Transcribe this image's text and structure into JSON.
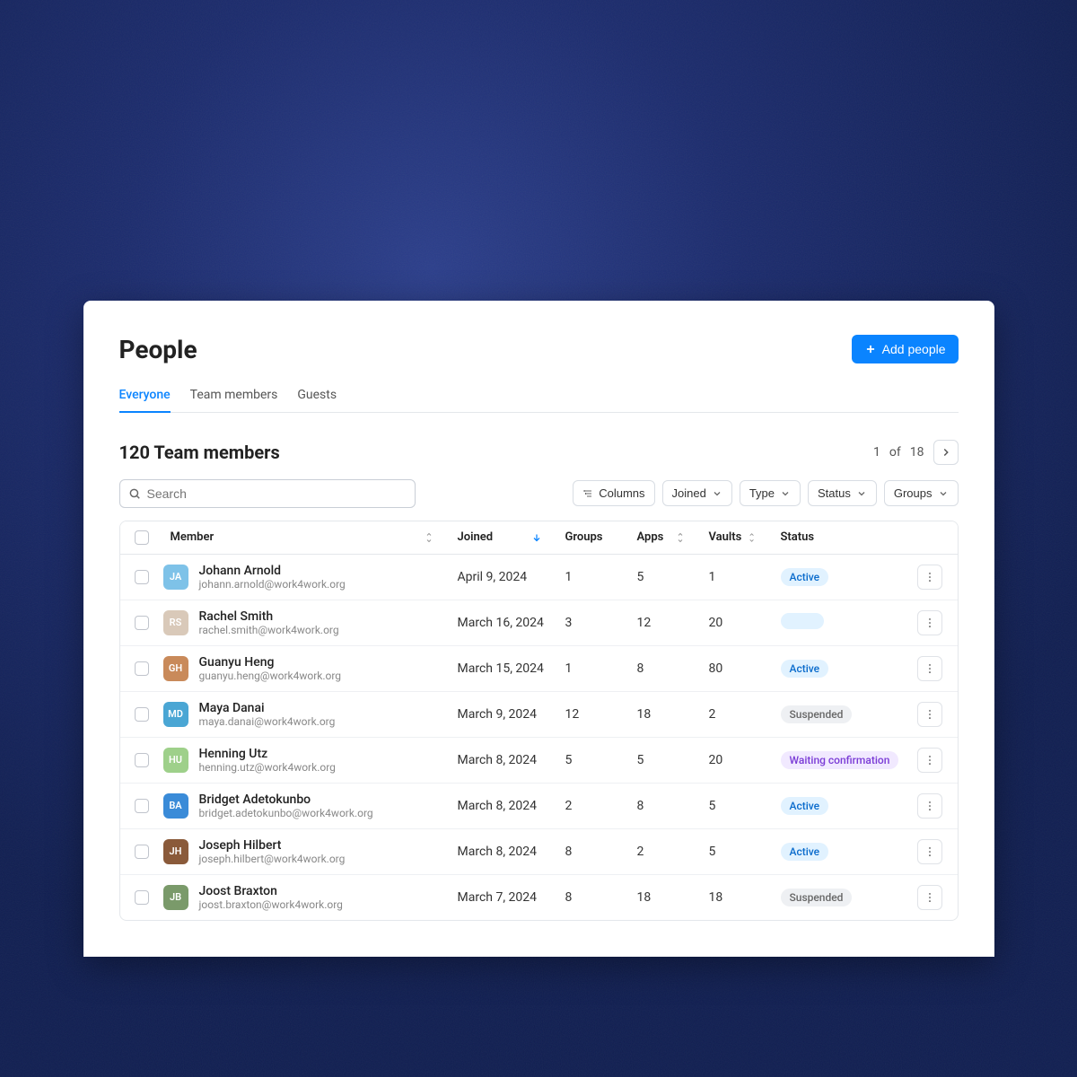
{
  "header": {
    "title": "People",
    "add_btn": "Add people"
  },
  "tabs": {
    "items": [
      {
        "label": "Everyone",
        "active": true
      },
      {
        "label": "Team members",
        "active": false
      },
      {
        "label": "Guests",
        "active": false
      }
    ]
  },
  "subhead": {
    "count_label": "120 Team members"
  },
  "pager": {
    "current": "1",
    "of": "of",
    "total": "18"
  },
  "search": {
    "placeholder": "Search"
  },
  "filters": {
    "columns": "Columns",
    "joined": "Joined",
    "type": "Type",
    "status": "Status",
    "groups": "Groups"
  },
  "columns": {
    "member": "Member",
    "joined": "Joined",
    "groups": "Groups",
    "apps": "Apps",
    "vaults": "Vaults",
    "status": "Status"
  },
  "statuses": {
    "active": "Active",
    "suspended": "Suspended",
    "waiting": "Waiting confirmation"
  },
  "rows": [
    {
      "initials": "JA",
      "avatar_bg": "#7ec2e8",
      "name": "Johann Arnold",
      "email": "johann.arnold@work4work.org",
      "joined": "April 9, 2024",
      "groups": "1",
      "apps": "5",
      "vaults": "1",
      "status": "active"
    },
    {
      "initials": "RS",
      "avatar_bg": "#d9c9b9",
      "name": "Rachel Smith",
      "email": "rachel.smith@work4work.org",
      "joined": "March 16, 2024",
      "groups": "3",
      "apps": "12",
      "vaults": "20",
      "status": "skeleton"
    },
    {
      "initials": "GH",
      "avatar_bg": "#c98a5a",
      "name": "Guanyu Heng",
      "email": "guanyu.heng@work4work.org",
      "joined": "March 15, 2024",
      "groups": "1",
      "apps": "8",
      "vaults": "80",
      "status": "active"
    },
    {
      "initials": "MD",
      "avatar_bg": "#4aa6d4",
      "name": "Maya Danai",
      "email": "maya.danai@work4work.org",
      "joined": "March 9, 2024",
      "groups": "12",
      "apps": "18",
      "vaults": "2",
      "status": "suspended"
    },
    {
      "initials": "HU",
      "avatar_bg": "#9ed08a",
      "name": "Henning Utz",
      "email": "henning.utz@work4work.org",
      "joined": "March 8, 2024",
      "groups": "5",
      "apps": "5",
      "vaults": "20",
      "status": "waiting"
    },
    {
      "initials": "BA",
      "avatar_bg": "#3a8bd8",
      "name": "Bridget Adetokunbo",
      "email": "bridget.adetokunbo@work4work.org",
      "joined": "March 8, 2024",
      "groups": "2",
      "apps": "8",
      "vaults": "5",
      "status": "active"
    },
    {
      "initials": "JH",
      "avatar_bg": "#8a5a3a",
      "name": "Joseph Hilbert",
      "email": "joseph.hilbert@work4work.org",
      "joined": "March 8, 2024",
      "groups": "8",
      "apps": "2",
      "vaults": "5",
      "status": "active"
    },
    {
      "initials": "JB",
      "avatar_bg": "#7a9a6a",
      "name": "Joost Braxton",
      "email": "joost.braxton@work4work.org",
      "joined": "March 7, 2024",
      "groups": "8",
      "apps": "18",
      "vaults": "18",
      "status": "suspended"
    }
  ]
}
